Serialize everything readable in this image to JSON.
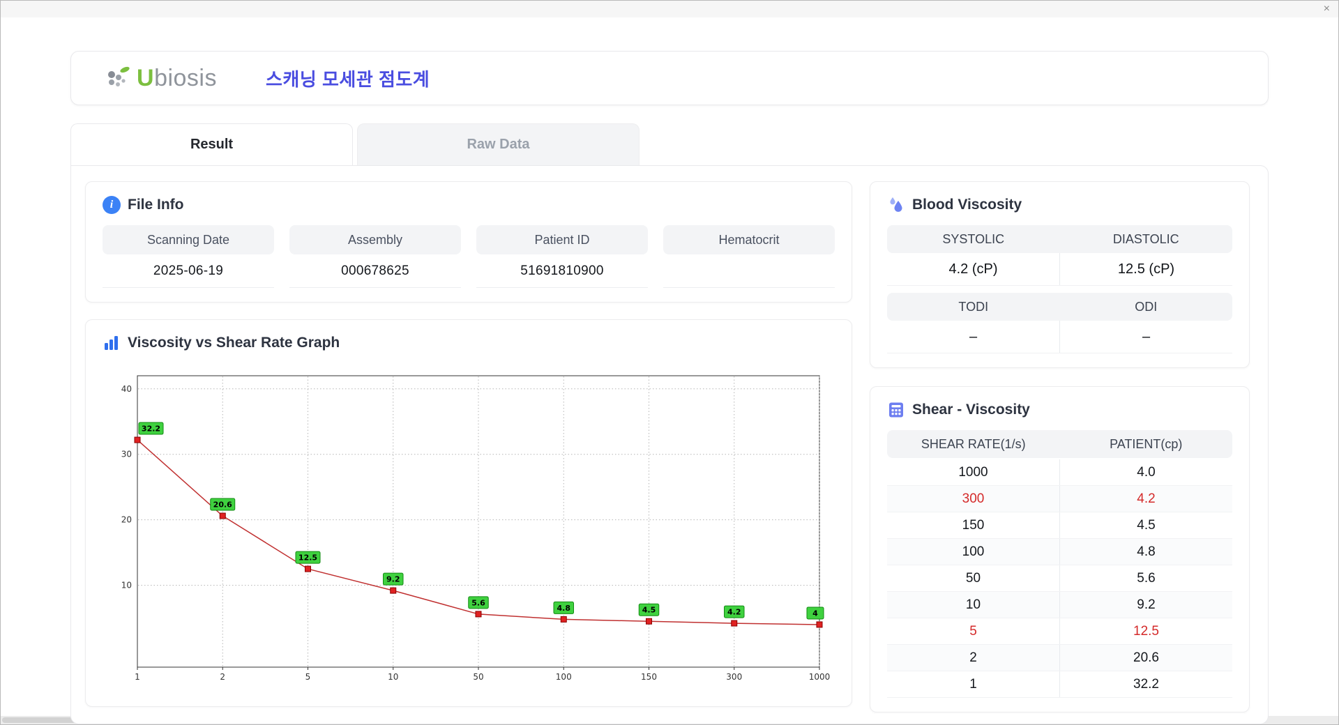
{
  "window": {
    "close_glyph": "×"
  },
  "header": {
    "logo": {
      "brand_initial": "U",
      "brand_rest": "biosis"
    },
    "title": "스캐닝 모세관 점도계"
  },
  "tabs": [
    {
      "label": "Result",
      "active": true
    },
    {
      "label": "Raw Data",
      "active": false
    }
  ],
  "file_info": {
    "title": "File Info",
    "fields": [
      {
        "label": "Scanning Date",
        "value": "2025-06-19"
      },
      {
        "label": "Assembly",
        "value": "000678625"
      },
      {
        "label": "Patient ID",
        "value": "51691810900"
      },
      {
        "label": "Hematocrit",
        "value": ""
      }
    ]
  },
  "graph": {
    "title": "Viscosity vs Shear Rate Graph"
  },
  "blood_viscosity": {
    "title": "Blood Viscosity",
    "cells": [
      {
        "label": "SYSTOLIC",
        "value": "4.2 (cP)"
      },
      {
        "label": "DIASTOLIC",
        "value": "12.5 (cP)"
      },
      {
        "label": "TODI",
        "value": "–"
      },
      {
        "label": "ODI",
        "value": "–"
      }
    ]
  },
  "shear_viscosity": {
    "title": "Shear - Viscosity",
    "columns": [
      "SHEAR RATE(1/s)",
      "PATIENT(cp)"
    ],
    "rows": [
      {
        "shear": "1000",
        "patient": "4.0",
        "highlight": false
      },
      {
        "shear": "300",
        "patient": "4.2",
        "highlight": true
      },
      {
        "shear": "150",
        "patient": "4.5",
        "highlight": false
      },
      {
        "shear": "100",
        "patient": "4.8",
        "highlight": false
      },
      {
        "shear": "50",
        "patient": "5.6",
        "highlight": false
      },
      {
        "shear": "10",
        "patient": "9.2",
        "highlight": false
      },
      {
        "shear": "5",
        "patient": "12.5",
        "highlight": true
      },
      {
        "shear": "2",
        "patient": "20.6",
        "highlight": false
      },
      {
        "shear": "1",
        "patient": "32.2",
        "highlight": false
      }
    ]
  },
  "chart_data": {
    "type": "line",
    "title": "Viscosity vs Shear Rate Graph",
    "xlabel": "",
    "ylabel": "",
    "x": [
      1,
      2,
      5,
      10,
      50,
      100,
      150,
      300,
      1000
    ],
    "values": [
      32.2,
      20.6,
      12.5,
      9.2,
      5.6,
      4.8,
      4.5,
      4.2,
      4
    ],
    "point_labels": [
      "32.2",
      "20.6",
      "12.5",
      "9.2",
      "5.6",
      "4.8",
      "4.5",
      "4.2",
      "4"
    ],
    "y_ticks": [
      10,
      20,
      30,
      40
    ],
    "ylim": [
      -2.5,
      42
    ],
    "x_axis_style": "category-spaced",
    "grid": "dotted",
    "line_color": "#c03030",
    "marker_color": "#e02222",
    "marker_border": "#8a0000",
    "label_bg": "#3fd13f",
    "label_border": "#128a12",
    "legend": "none"
  }
}
